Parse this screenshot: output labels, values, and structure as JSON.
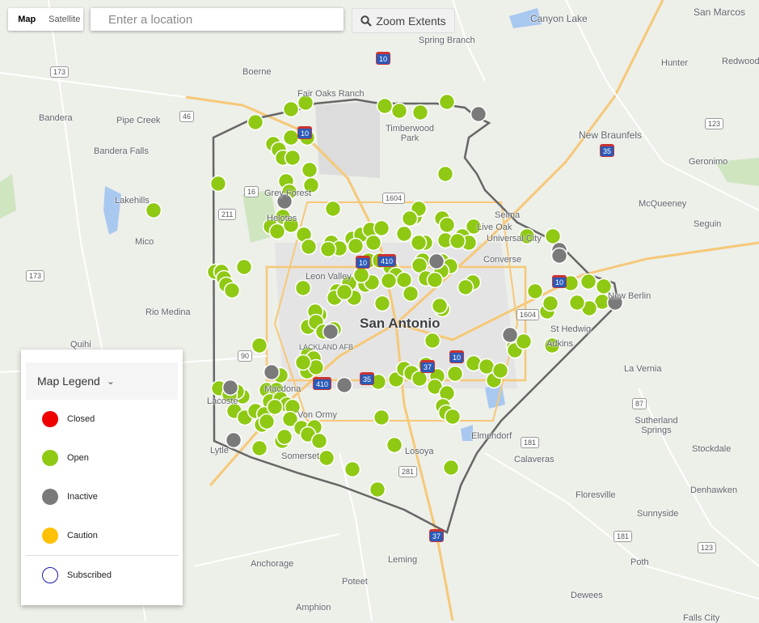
{
  "map_type": {
    "map_label": "Map",
    "satellite_label": "Satellite",
    "selected": "Map"
  },
  "search": {
    "placeholder": "Enter a location"
  },
  "zoom_extents": {
    "label": "Zoom Extents",
    "icon": "search-icon"
  },
  "legend": {
    "title": "Map Legend",
    "items": [
      {
        "label": "Closed",
        "color": "#ee0000"
      },
      {
        "label": "Open",
        "color": "#8fc914"
      },
      {
        "label": "Inactive",
        "color": "#7a7a7a"
      },
      {
        "label": "Caution",
        "color": "#ffc107"
      },
      {
        "label": "Subscribed",
        "color": "#1a1aa8"
      }
    ]
  },
  "map_labels": {
    "san_antonio": "San Antonio",
    "canyon_lake": "Canyon Lake",
    "san_marcos": "San Marcos",
    "spring_branch": "Spring Branch",
    "boerne": "Boerne",
    "fair_oaks_ranch": "Fair Oaks Ranch",
    "timberwood_park": "Timberwood Park",
    "bandera": "Bandera",
    "pipe_creek": "Pipe Creek",
    "bandera_falls": "Bandera Falls",
    "lakehills": "Lakehills",
    "mico": "Mico",
    "new_braunfels": "New Braunfels",
    "hunter": "Hunter",
    "redwood": "Redwood",
    "geronimo": "Geronimo",
    "mcqueeney": "McQueeney",
    "seguin": "Seguin",
    "leon_valley": "Leon Valley",
    "converse": "Converse",
    "live_oak": "Live Oak",
    "universal_city": "Universal City",
    "new_berlin": "New Berlin",
    "st_hedwig": "St Hedwig",
    "adkins": "Adkins",
    "la_vernia": "La Vernia",
    "sutherland_springs": "Sutherland Springs",
    "stockdale": "Stockdale",
    "elmendorf": "Elmendorf",
    "losoya": "Losoya",
    "somerset": "Somerset",
    "von_ormy": "Von Ormy",
    "macdona": "Macdona",
    "lytle": "Lytle",
    "lacoste": "Lacoste",
    "rio_medina": "Rio Medina",
    "quihi": "Quihi",
    "calaveras": "Calaveras",
    "floresville": "Floresville",
    "sunnyside": "Sunnyside",
    "poth": "Poth",
    "denhawken": "Denhawken",
    "anchorage": "Anchorage",
    "leming": "Leming",
    "poteet": "Poteet",
    "amphion": "Amphion",
    "dewees": "Dewees",
    "falls_city": "Falls City",
    "helotes": "Helotes",
    "grey_forest": "Grey Forest",
    "lackland_afb": "LACKLAND AFB",
    "selma": "Selma"
  }
}
